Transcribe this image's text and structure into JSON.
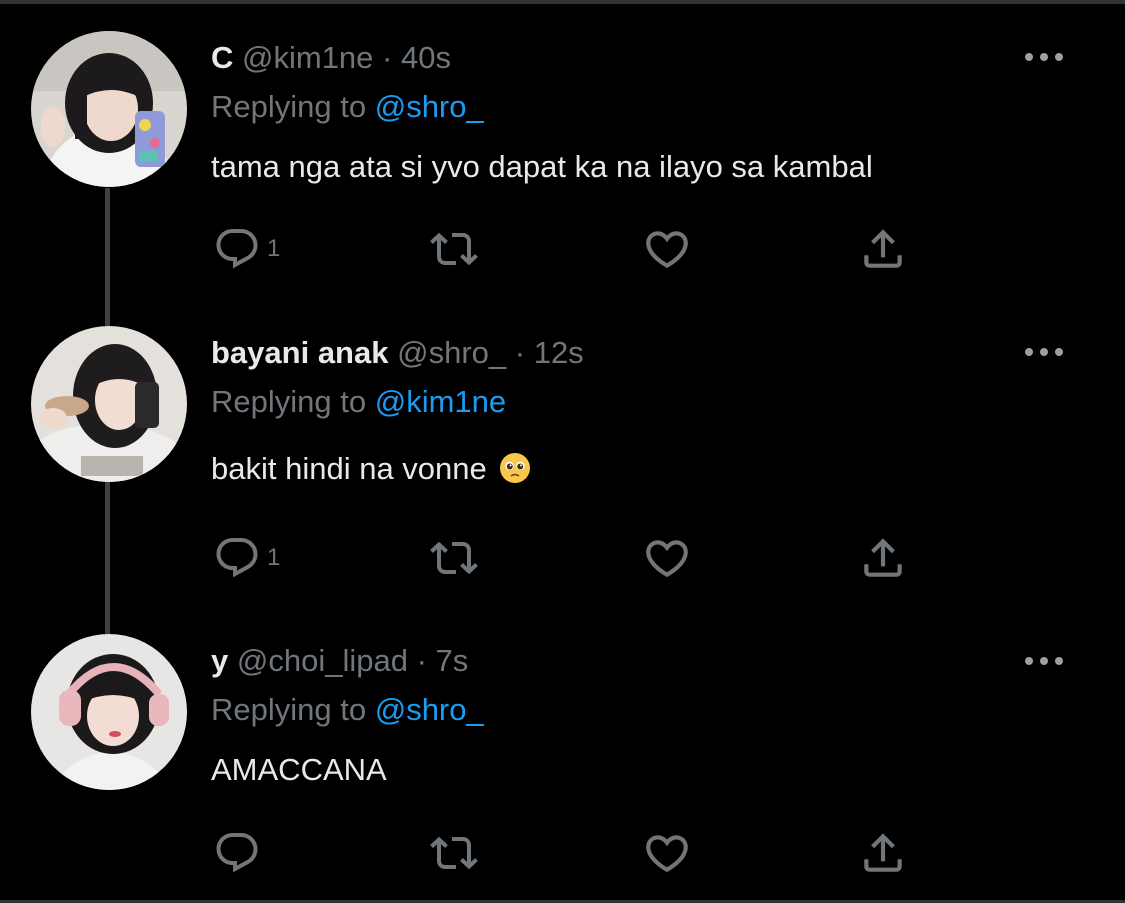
{
  "colors": {
    "background": "#000000",
    "text": "#e7e9ea",
    "muted": "#71767b",
    "mention": "#1d9bf0",
    "thread_line": "#3e4144"
  },
  "tweets": [
    {
      "display_name": "C",
      "handle": "@kim1ne",
      "separator": "·",
      "time": "40s",
      "replying_prefix": "Replying to",
      "replying_to": "@shro_",
      "text": "tama nga ata si yvo dapat ka na ilayo sa kambal",
      "reply_count": "1",
      "more_icon": "more-dots-icon"
    },
    {
      "display_name": "bayani anak",
      "handle": "@shro_",
      "separator": "·",
      "time": "12s",
      "replying_prefix": "Replying to",
      "replying_to": "@kim1ne",
      "text": "bakit hindi na vonne",
      "text_emoji": "pleading-face-emoji",
      "reply_count": "1",
      "more_icon": "more-dots-icon"
    },
    {
      "display_name": "y",
      "handle": "@choi_lipad",
      "separator": "·",
      "time": "7s",
      "replying_prefix": "Replying to",
      "replying_to": "@shro_",
      "text": "AMACCANA",
      "reply_count": "",
      "more_icon": "more-dots-icon"
    }
  ],
  "action_icons": [
    "reply-icon",
    "retweet-icon",
    "like-icon",
    "share-icon"
  ]
}
